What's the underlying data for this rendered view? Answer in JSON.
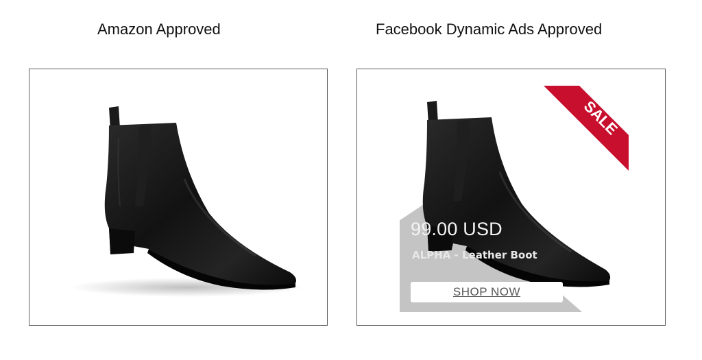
{
  "left_panel": {
    "caption": "Amazon Approved"
  },
  "right_panel": {
    "caption": "Facebook Dynamic Ads Approved",
    "badge_text": "SALE",
    "price": "99.00 USD",
    "product_name": "ALPHA - Leather Boot",
    "cta_label": "SHOP NOW"
  },
  "colors": {
    "badge_red": "#c8102e",
    "overlay_gray": "#c4c4c4",
    "frame_border": "#5a5a5a"
  },
  "icons": [
    "boot-image",
    "sale-ribbon-icon"
  ]
}
